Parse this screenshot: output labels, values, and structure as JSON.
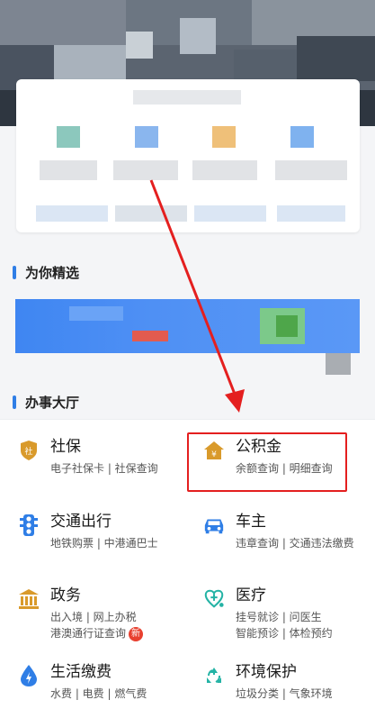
{
  "sections": {
    "recommended_title": "为你精选",
    "service_hall_title": "办事大厅"
  },
  "services": [
    {
      "name": "社保",
      "line1": "电子社保卡 | 社保查询",
      "line2": "",
      "icon": "shield-icon",
      "color": "#d99a2b"
    },
    {
      "name": "公积金",
      "line1": "余额查询 | 明细查询",
      "line2": "",
      "icon": "house-yuan-icon",
      "color": "#d99a2b"
    },
    {
      "name": "交通出行",
      "line1": "地铁购票 | 中港通巴士",
      "line2": "",
      "icon": "traffic-light-icon",
      "color": "#2f7ee6"
    },
    {
      "name": "车主",
      "line1": "违章查询 | 交通违法缴费",
      "line2": "",
      "icon": "car-icon",
      "color": "#2f7ee6"
    },
    {
      "name": "政务",
      "line1": "出入境 | 网上办税",
      "line2": "港澳通行证查询",
      "icon": "government-building-icon",
      "color": "#d99a2b"
    },
    {
      "name": "医疗",
      "line1": "挂号就诊 | 问医生",
      "line2": "智能预诊 | 体检预约",
      "icon": "stethoscope-heart-icon",
      "color": "#24b3a5"
    },
    {
      "name": "生活缴费",
      "line1": "水费 | 电费 | 燃气费",
      "line2": "",
      "icon": "water-drop-icon",
      "color": "#2f7ee6"
    },
    {
      "name": "环境保护",
      "line1": "垃圾分类 | 气象环境",
      "line2": "",
      "icon": "recycle-icon",
      "color": "#24b3a5"
    }
  ],
  "badge": {
    "new": "新"
  },
  "colors": {
    "accent": "#2f7ee6",
    "highlight": "#e41f1f",
    "arrow": "#e41f1f"
  }
}
